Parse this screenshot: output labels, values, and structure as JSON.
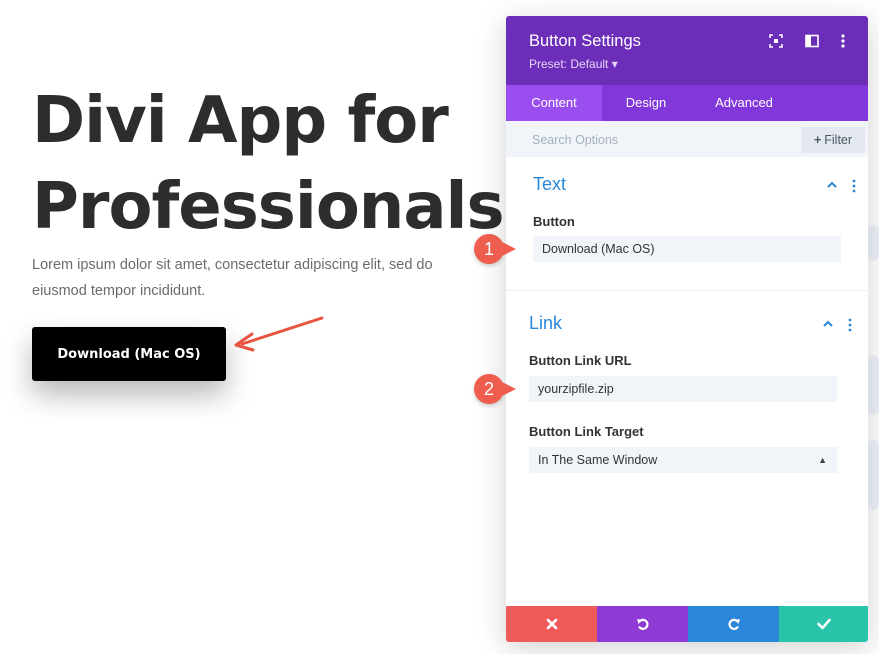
{
  "hero": {
    "title_line1": "Divi App for",
    "title_line2": "Professionals",
    "text": "Lorem ipsum dolor sit amet, consectetur adipiscing elit, sed do eiusmod tempor incididunt.",
    "button_label": "Download (Mac OS)"
  },
  "panel": {
    "title": "Button Settings",
    "preset": "Preset: Default ▾",
    "tabs": [
      {
        "label": "Content",
        "active": true
      },
      {
        "label": "Design",
        "active": false
      },
      {
        "label": "Advanced",
        "active": false
      }
    ],
    "search_placeholder": "Search Options",
    "filter_label": "Filter",
    "sections": {
      "text": {
        "title": "Text",
        "button_label": "Button",
        "button_value": "Download (Mac OS)"
      },
      "link": {
        "title": "Link",
        "url_label": "Button Link URL",
        "url_value": "yourzipfile.zip",
        "target_label": "Button Link Target",
        "target_value": "In The Same Window"
      }
    },
    "footer_colors": {
      "cancel": "#ef5b5b",
      "undo": "#8e3ad4",
      "redo": "#2b87da",
      "save": "#29c4a9"
    }
  },
  "markers": [
    "1",
    "2"
  ],
  "colors": {
    "header": "#6c2eb9",
    "tabs": "#8137d9",
    "accent": "#2b87da",
    "marker": "#ef5d4f"
  }
}
